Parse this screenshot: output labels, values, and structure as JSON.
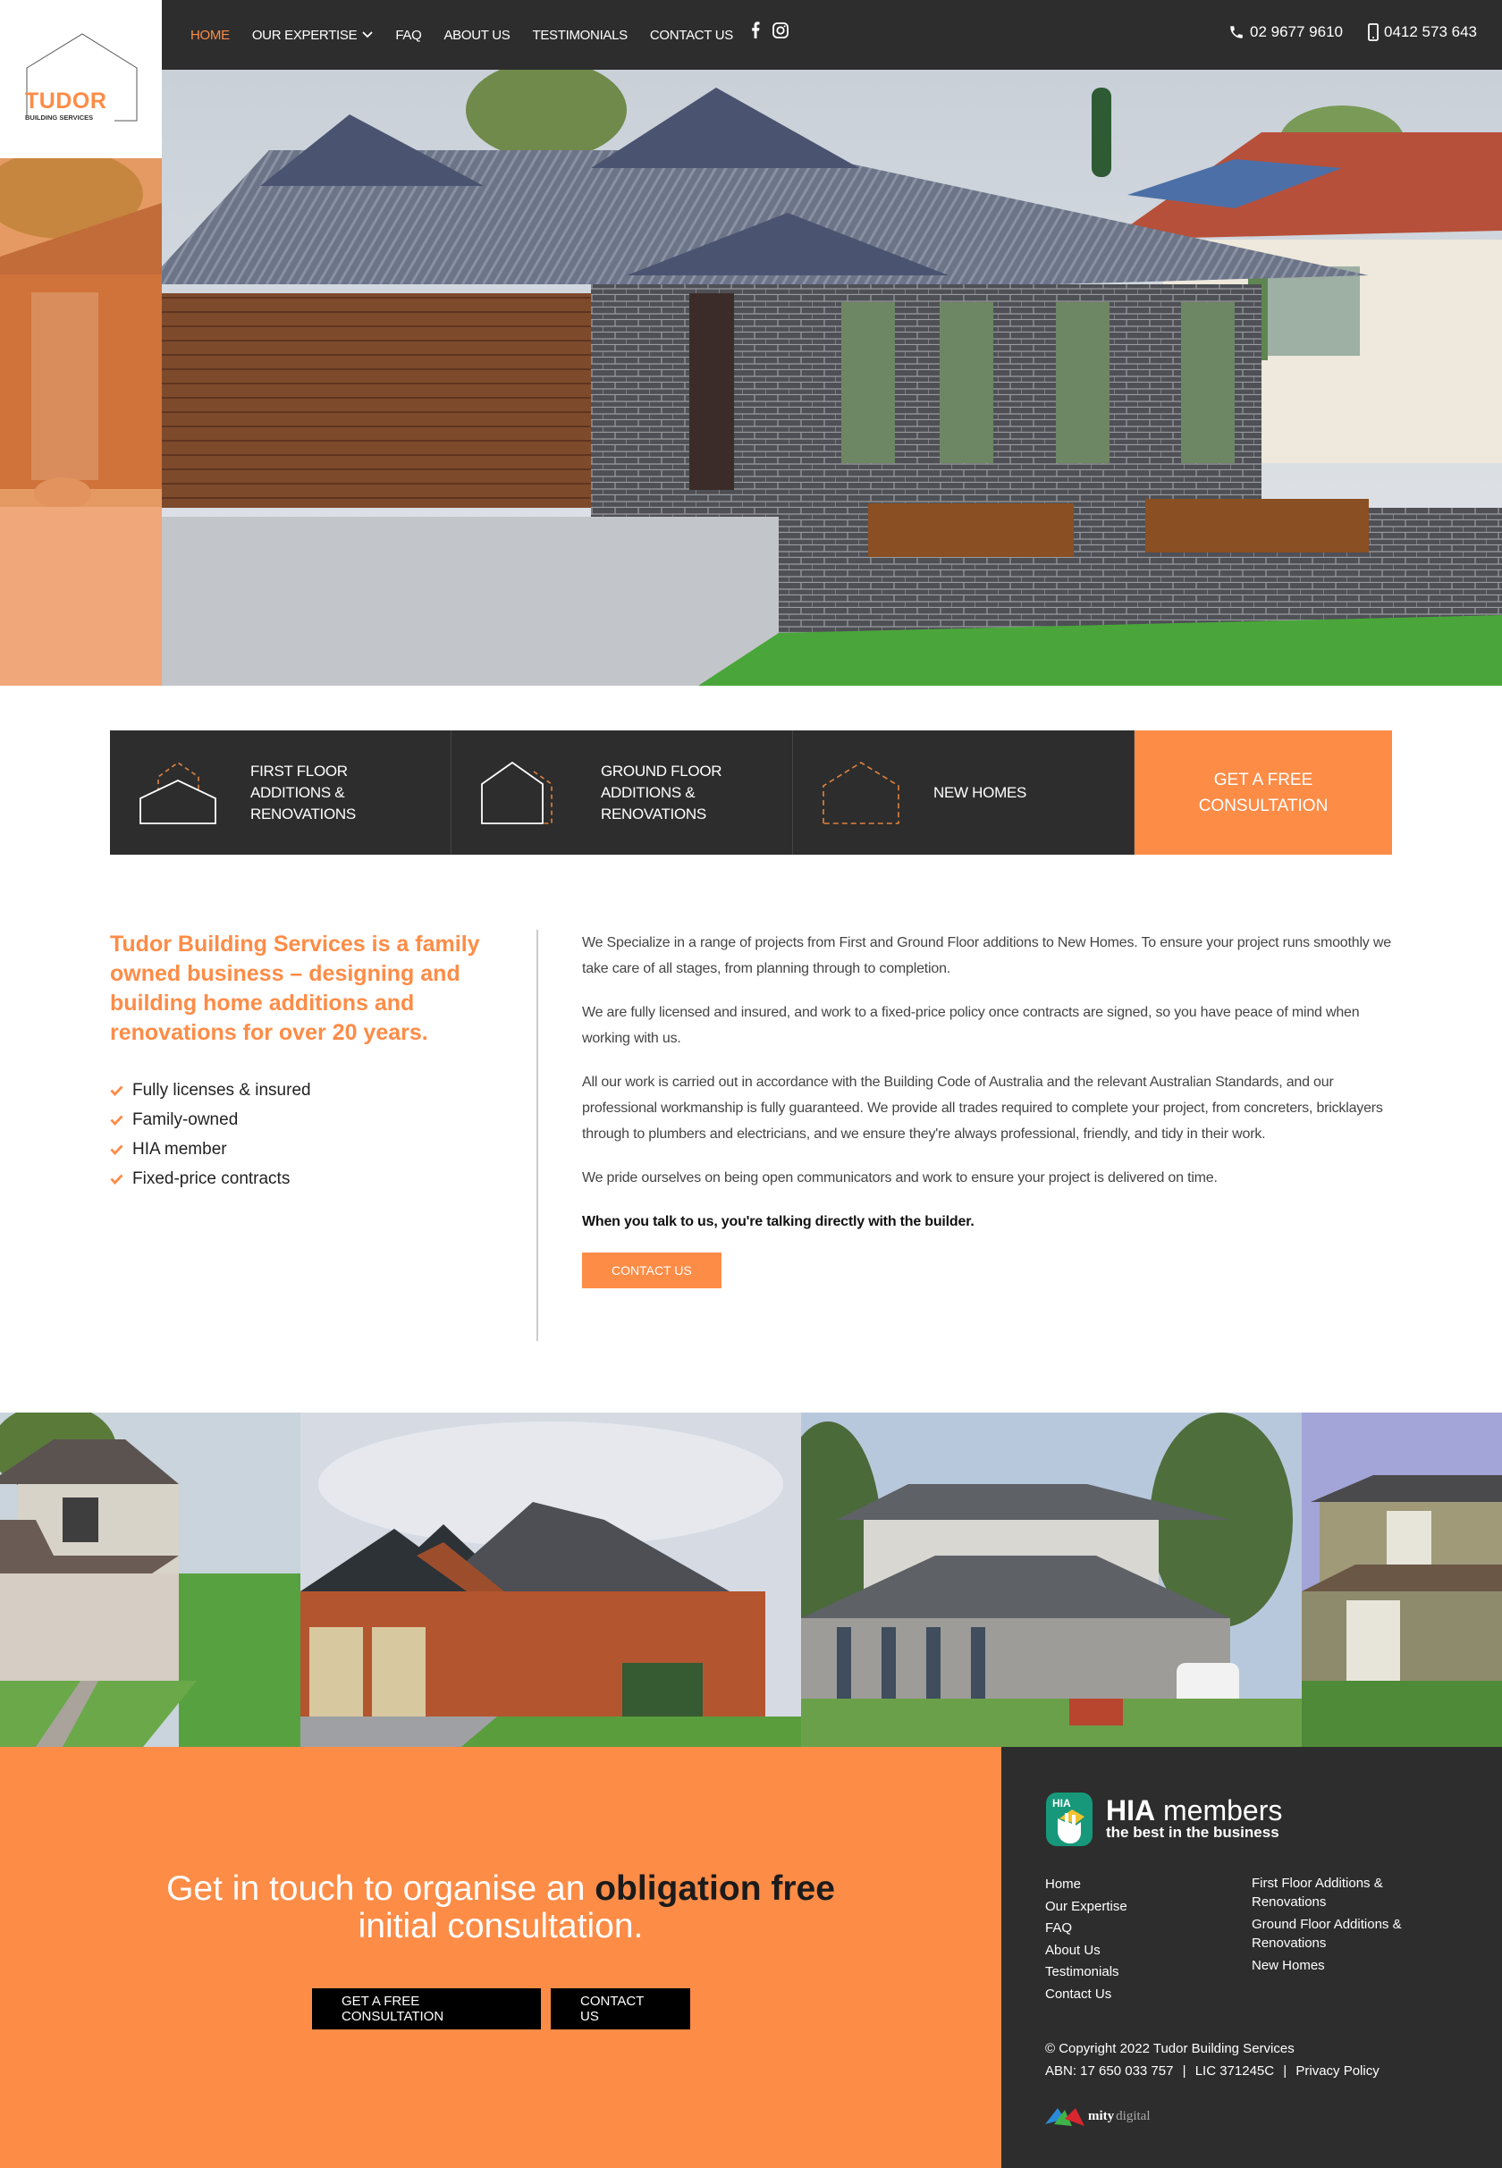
{
  "brand": {
    "name": "TUDOR",
    "tagline": "BUILDING SERVICES",
    "accent": "#fd8c47",
    "dark": "#2d2d2d"
  },
  "nav": {
    "items": [
      {
        "label": "HOME",
        "active": true
      },
      {
        "label": "OUR EXPERTISE",
        "dropdown": true
      },
      {
        "label": "FAQ"
      },
      {
        "label": "ABOUT US"
      },
      {
        "label": "TESTIMONIALS"
      },
      {
        "label": "CONTACT US"
      }
    ],
    "social": [
      "facebook-icon",
      "instagram-icon"
    ],
    "phone": "02 9677 9610",
    "mobile": "0412 573 643"
  },
  "services": {
    "items": [
      {
        "label": "FIRST FLOOR ADDITIONS & RENOVATIONS",
        "icon": "first-floor-house-icon"
      },
      {
        "label": "GROUND FLOOR ADDITIONS & RENOVATIONS",
        "icon": "ground-floor-house-icon"
      },
      {
        "label": "NEW HOMES",
        "icon": "new-home-icon"
      }
    ],
    "cta": "GET A FREE CONSULTATION"
  },
  "about": {
    "headline": "Tudor Building Services is a family owned business – designing and building home additions and renovations for over 20 years.",
    "checklist": [
      "Fully licenses & insured",
      "Family-owned",
      "HIA member",
      "Fixed-price contracts"
    ],
    "paragraphs": [
      "We Specialize in a range of projects from First and Ground Floor additions to New Homes. To ensure your project runs smoothly we take care of all stages, from planning through to completion.",
      "We are fully licensed and insured, and work to a fixed-price policy once contracts are signed, so you have peace of mind when working with us.",
      "All our work is carried out in accordance with the Building Code of Australia and the relevant Australian Standards, and our professional workmanship is fully guaranteed. We provide all trades required to complete your project, from concreters, bricklayers through to plumbers and electricians, and we ensure they're always professional, friendly, and tidy in their work.",
      "We pride ourselves on being open communicators and work to ensure your project is delivered on time."
    ],
    "bold_line": "When you talk to us, you're talking directly with the builder.",
    "button": "CONTACT US"
  },
  "cta": {
    "text_pre": "Get in touch to organise an ",
    "text_bold": "obligation free",
    "text_post": "initial consultation.",
    "button_primary": "GET A FREE CONSULTATION",
    "button_secondary": "CONTACT US"
  },
  "footer": {
    "hia_title": "HIA",
    "hia_members": "members",
    "hia_tagline": "the best in the business",
    "links_left": [
      "Home",
      "Our Expertise",
      "FAQ",
      "About Us",
      "Testimonials",
      "Contact Us"
    ],
    "links_right": [
      "First Floor Additions & Renovations",
      "Ground Floor Additions & Renovations",
      "New Homes"
    ],
    "copyright": "© Copyright 2022 Tudor Building Services",
    "abn": "ABN: 17 650 033 757",
    "lic": "LIC 371245C",
    "privacy": "Privacy Policy",
    "credit_bold": "mity",
    "credit_light": "digital"
  }
}
